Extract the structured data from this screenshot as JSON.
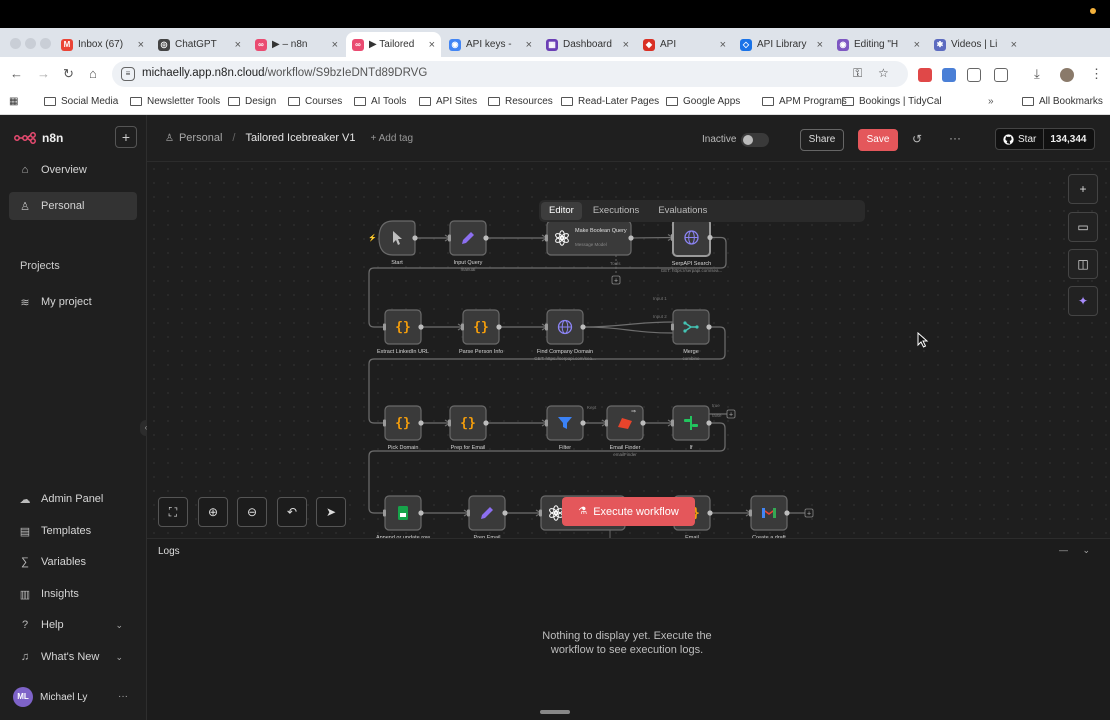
{
  "browser": {
    "tabs": [
      {
        "label": "Inbox (67)",
        "fav": "M",
        "color": "#ea4335"
      },
      {
        "label": "ChatGPT",
        "fav": "◎",
        "color": "#444444"
      },
      {
        "label": "▶ – n8n",
        "fav": "∞",
        "color": "#ea4b71"
      },
      {
        "label": "▶ Tailored",
        "fav": "∞",
        "color": "#ea4b71",
        "active": true
      },
      {
        "label": "API keys -",
        "fav": "◉",
        "color": "#4285f4"
      },
      {
        "label": "Dashboard",
        "fav": "▦",
        "color": "#6b3fb5"
      },
      {
        "label": "API",
        "fav": "◆",
        "color": "#d93025"
      },
      {
        "label": "API Library",
        "fav": "◇",
        "color": "#1a73e8"
      },
      {
        "label": "Editing \"H",
        "fav": "◉",
        "color": "#7e57c2"
      },
      {
        "label": "Videos | Li",
        "fav": "✱",
        "color": "#5c6bc0"
      }
    ],
    "url_host": "michaelly.app.n8n.cloud",
    "url_path": "/workflow/S9bzIeDNTd89DRVG",
    "bookmarks": [
      "Social Media",
      "Newsletter Tools",
      "Design",
      "Courses",
      "AI Tools",
      "API Sites",
      "Resources",
      "Read-Later Pages",
      "Google Apps",
      "APM Programs",
      "Bookings | TidyCal"
    ],
    "all_bookmarks": "All Bookmarks"
  },
  "sidebar": {
    "brand": "n8n",
    "top_items": [
      {
        "label": "Overview",
        "icon": "home-icon"
      },
      {
        "label": "Personal",
        "icon": "user-icon",
        "active": true
      }
    ],
    "projects_heading": "Projects",
    "projects": [
      {
        "label": "My project",
        "icon": "layers-icon"
      }
    ],
    "bottom_items": [
      {
        "label": "Admin Panel",
        "icon": "cloud-icon"
      },
      {
        "label": "Templates",
        "icon": "templates-icon"
      },
      {
        "label": "Variables",
        "icon": "variables-icon"
      },
      {
        "label": "Insights",
        "icon": "insights-icon"
      },
      {
        "label": "Help",
        "icon": "help-icon",
        "chevron": true
      },
      {
        "label": "What's New",
        "icon": "bell-icon",
        "chevron": true
      }
    ],
    "user": {
      "initials": "ML",
      "name": "Michael Ly"
    }
  },
  "header": {
    "project": "Personal",
    "workflow_title": "Tailored Icebreaker V1",
    "add_tag": "+ Add tag",
    "status": "Inactive",
    "share": "Share",
    "save": "Save",
    "github_star": "Star",
    "github_count": "134,344"
  },
  "mode_tabs": [
    "Editor",
    "Executions",
    "Evaluations"
  ],
  "workflow": {
    "nodes": [
      {
        "label": "Start",
        "sub": "",
        "icon": "cursor-icon",
        "color": "#bdbdbd"
      },
      {
        "label": "Input Query",
        "sub": "manual",
        "icon": "pencil-icon",
        "color": "#8c6ff0"
      },
      {
        "label": "Make Boolean Query",
        "sub": "Message Model",
        "icon": "openai-icon",
        "color": "#ffffff"
      },
      {
        "label": "SerpAPI Search",
        "sub": "GET: https://serpapi.com/sea...",
        "icon": "globe-icon",
        "color": "#8c84f5"
      },
      {
        "label": "Extract LinkedIn URL",
        "sub": "",
        "icon": "code-icon",
        "color": "#f59e0b"
      },
      {
        "label": "Parse Person Info",
        "sub": "",
        "icon": "code-icon",
        "color": "#f59e0b"
      },
      {
        "label": "Find Company Domain",
        "sub": "GET: https://serpapi.com/sea...",
        "icon": "globe-icon",
        "color": "#8c84f5"
      },
      {
        "label": "Merge",
        "sub": "combine",
        "icon": "merge-icon",
        "color": "#44c4b4"
      },
      {
        "label": "Pick Domain",
        "sub": "",
        "icon": "code-icon",
        "color": "#f59e0b"
      },
      {
        "label": "Prep for Email",
        "sub": "",
        "icon": "code-icon",
        "color": "#f59e0b"
      },
      {
        "label": "Filter",
        "sub": "",
        "icon": "filter-icon",
        "color": "#3b82f6"
      },
      {
        "label": "Email Finder",
        "sub": "emailFinder",
        "icon": "hunter-icon",
        "color": "#e8442b"
      },
      {
        "label": "If",
        "sub": "",
        "icon": "if-icon",
        "color": "#22c55e"
      },
      {
        "label": "Append or update row in sheet",
        "sub": "appendOrUpdate: sheet",
        "icon": "sheets-icon",
        "color": "#16a34a"
      },
      {
        "label": "Prep Email",
        "sub": "manual",
        "icon": "pencil-icon",
        "color": "#8c6ff0"
      },
      {
        "label": "Personalized",
        "sub": "",
        "icon": "openai-icon",
        "color": "#ffffff"
      },
      {
        "label": "Email",
        "sub": "",
        "icon": "code-icon",
        "color": "#f59e0b"
      },
      {
        "label": "Create a draft",
        "sub": "create: draft",
        "icon": "gmail-icon",
        "color": "#ea4335"
      }
    ],
    "edge_labels": {
      "tools": "Tools",
      "input1": "Input 1",
      "input2": "Input 2",
      "kept": "Kept",
      "true": "true",
      "false": "false"
    }
  },
  "canvas": {
    "execute_label": "Execute workflow",
    "controls": [
      "fit-view-icon",
      "zoom-in-icon",
      "zoom-out-icon",
      "undo-icon",
      "tidy-icon"
    ],
    "right_tools": [
      "plus-icon",
      "sticky-note-icon",
      "panel-icon",
      "ai-sparkle-icon"
    ]
  },
  "logs": {
    "title": "Logs",
    "empty_message": "Nothing to display yet. Execute the workflow to see execution logs."
  }
}
